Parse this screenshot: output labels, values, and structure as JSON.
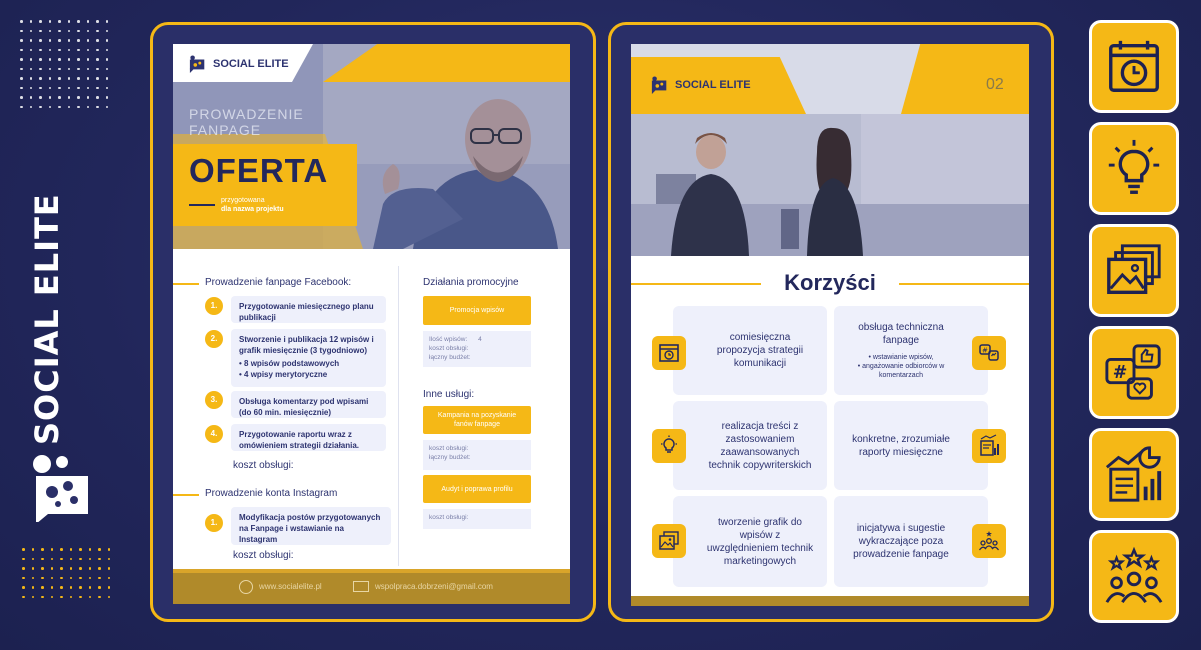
{
  "brand": {
    "name": "SOCIAL ELITE"
  },
  "page1": {
    "logo": "SOCIAL ELITE",
    "subtitle_line1": "PROWADZENIE",
    "subtitle_line2": "FANPAGE",
    "title": "OFERTA",
    "prepared": "przygotowana",
    "prepared_for": "dla nazwa projektu",
    "facebook_heading": "Prowadzenie fanpage Facebook:",
    "facebook_items": [
      {
        "num": "1.",
        "text": "Przygotowanie miesięcznego planu publikacji"
      },
      {
        "num": "2.",
        "text": "Stworzenie i publikacja 12 wpisów i grafik miesięcznie (3 tygodniowo)",
        "bullets": [
          "8 wpisów podstawowych",
          "4 wpisy merytoryczne"
        ]
      },
      {
        "num": "3.",
        "text": "Obsługa komentarzy pod wpisami (do 60 min. miesięcznie)"
      },
      {
        "num": "4.",
        "text": "Przygotowanie raportu wraz z omówieniem strategii działania."
      }
    ],
    "cost_label_1": "koszt obsługi:",
    "instagram_heading": "Prowadzenie konta Instagram",
    "instagram_items": [
      {
        "num": "1.",
        "text": "Modyfikacja postów przygotowanych na Fanpage i wstawianie na Instagram"
      }
    ],
    "cost_label_2": "koszt obsługi:",
    "promo_heading": "Działania promocyjne",
    "promo_button": "Promocja wpisów",
    "promo_detail_1": "Ilość wpisów:",
    "promo_detail_1_value": "4",
    "promo_detail_2": "koszt obsługi:",
    "promo_detail_3": "łączny budżet:",
    "other_heading": "Inne usługi:",
    "other_button_1": "Kampania na pozyskanie fanów fanpage",
    "other_detail_1": "koszt obsługi:",
    "other_detail_2": "łączny budżet:",
    "other_button_2": "Audyt i poprawa profilu",
    "other_detail_3": "koszt obsługi:",
    "footer_web": "www.socialelite.pl",
    "footer_mail": "wspolpraca.dobrzeni@gmail.com"
  },
  "page2": {
    "logo": "SOCIAL ELITE",
    "page_number": "02",
    "heading": "Korzyści",
    "cards": [
      {
        "text": "comiesięczna propozycja strategii komunikacji",
        "icon": "calendar-clock-icon"
      },
      {
        "text": "obsługa techniczna fanpage",
        "bullets": [
          "wstawianie wpisów,",
          "angażowanie odbiorców w komentarzach"
        ],
        "icon": "social-icon"
      },
      {
        "text": "realizacja treści z zastosowaniem zaawansowanych technik copywriterskich",
        "icon": "lightbulb-icon"
      },
      {
        "text": "konkretne, zrozumiałe raporty miesięczne",
        "icon": "report-icon"
      },
      {
        "text": "tworzenie grafik do wpisów z uwzględnieniem technik marketingowych",
        "icon": "images-icon"
      },
      {
        "text": "inicjatywa i sugestie wykraczające poza prowadzenie fanpage",
        "icon": "team-stars-icon"
      }
    ]
  },
  "side_icons": [
    "calendar-clock-icon",
    "lightbulb-icon",
    "images-icon",
    "social-media-icon",
    "analytics-icon",
    "team-stars-icon"
  ],
  "colors": {
    "navy": "#23285c",
    "yellow": "#f5b816",
    "light": "#eef0fb"
  }
}
